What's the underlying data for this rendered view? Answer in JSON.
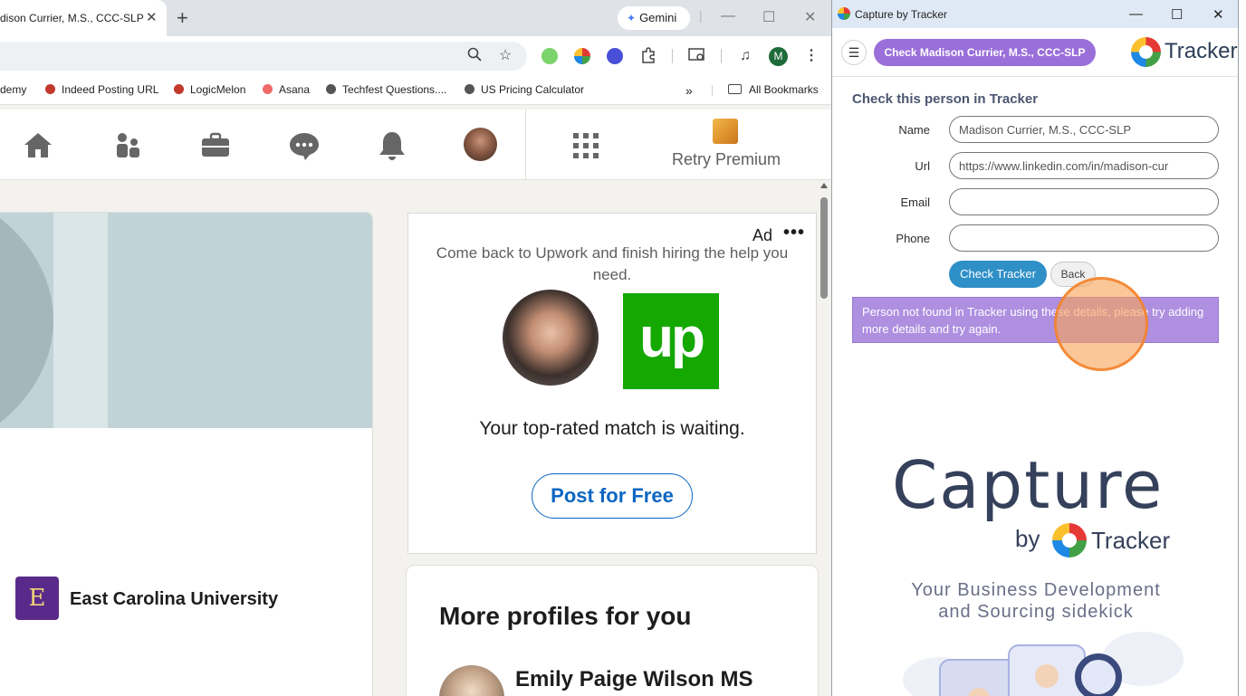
{
  "browser": {
    "tab_title": "dison Currier, M.S., CCC-SLP",
    "gemini_label": "Gemini",
    "bookmarks": [
      {
        "label": "demy"
      },
      {
        "label": "Indeed Posting URL"
      },
      {
        "label": "LogicMelon"
      },
      {
        "label": "Asana"
      },
      {
        "label": "Techfest Questions...."
      },
      {
        "label": "US Pricing Calculator"
      }
    ],
    "all_bookmarks_label": "All Bookmarks",
    "avatar_letter": "M"
  },
  "linkedin": {
    "premium_label": "Retry Premium",
    "university_logo_letter": "E",
    "university_name": "East Carolina University",
    "ad": {
      "tag": "Ad",
      "text": "Come back to Upwork and finish hiring the help you need.",
      "logo_text": "up",
      "tagline": "Your top-rated match is waiting.",
      "cta": "Post for Free"
    },
    "more_profiles_title": "More profiles for you",
    "more_profiles": [
      {
        "name": "Emily Paige Wilson MS"
      }
    ]
  },
  "capture": {
    "window_title": "Capture by Tracker",
    "check_pill": "Check Madison Currier, M.S., CCC-SLP",
    "logo_word": "Tracker",
    "form_heading": "Check this person in Tracker",
    "fields": {
      "name": {
        "label": "Name",
        "value": "Madison Currier, M.S., CCC-SLP"
      },
      "url": {
        "label": "Url",
        "value": "https://www.linkedin.com/in/madison-cur"
      },
      "email": {
        "label": "Email",
        "value": ""
      },
      "phone": {
        "label": "Phone",
        "value": ""
      }
    },
    "check_button": "Check Tracker",
    "back_button": "Back",
    "alert": "Person not found in Tracker using these details, please try adding more details and try again.",
    "brand": {
      "capture_word": "Capture",
      "by_word": "by",
      "tracker_word": "Tracker",
      "sidekick_line1": "Your Business Development",
      "sidekick_line2": "and Sourcing sidekick"
    }
  },
  "colors": {
    "pill_purple": "#9a6fd9",
    "alert_purple": "#ae8fe0",
    "check_blue": "#2f8fc7",
    "upwork_green": "#14a800",
    "linkedin_blue": "#0a66c2",
    "click_highlight": "#f8a55a"
  }
}
